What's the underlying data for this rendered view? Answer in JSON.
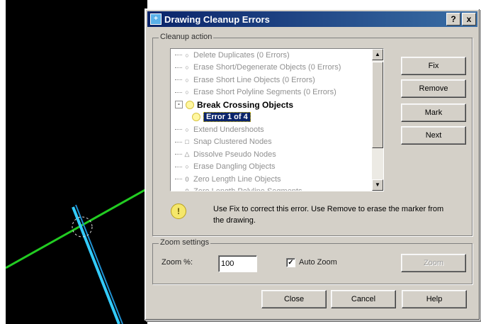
{
  "dialog": {
    "title": "Drawing Cleanup Errors",
    "help_button": "?",
    "close_button": "x"
  },
  "cleanup": {
    "legend": "Cleanup action",
    "items": [
      {
        "label": "Delete Duplicates (0 Errors)",
        "marker": "circle"
      },
      {
        "label": "Erase Short/Degenerate Objects (0 Errors)",
        "marker": "circle"
      },
      {
        "label": "Erase Short Line Objects (0 Errors)",
        "marker": "circle"
      },
      {
        "label": "Erase Short Polyline Segments (0 Errors)",
        "marker": "circle"
      },
      {
        "label": "Break Crossing Objects",
        "marker": "bulb",
        "expanded": "-",
        "bold": true
      },
      {
        "label": "Error 1 of 4",
        "marker": "bulb",
        "selected": true,
        "child": true
      },
      {
        "label": "Extend Undershoots",
        "marker": "circle"
      },
      {
        "label": "Snap Clustered Nodes",
        "marker": "square"
      },
      {
        "label": "Dissolve Pseudo Nodes",
        "marker": "triangle"
      },
      {
        "label": "Erase Dangling Objects",
        "marker": "circle"
      },
      {
        "label": "Zero Length Line Objects",
        "marker": "zero"
      },
      {
        "label": "Zero Length Polyline Segments",
        "marker": "zero"
      }
    ]
  },
  "buttons": {
    "fix": "Fix",
    "remove": "Remove",
    "mark": "Mark",
    "next": "Next",
    "zoom": "Zoom",
    "close": "Close",
    "cancel": "Cancel",
    "help": "Help"
  },
  "info": {
    "text": "Use Fix to correct this error. Use Remove to erase the marker from the drawing."
  },
  "zoom_settings": {
    "legend": "Zoom settings",
    "zoom_label": "Zoom %:",
    "zoom_value": "100",
    "auto_zoom_label": "Auto Zoom",
    "auto_zoom_checked": "✓"
  },
  "colors": {
    "canvas_bg": "#000000",
    "green_line": "#22cc22",
    "cyan_line": "#33ccff",
    "selection": "#0a246a"
  }
}
